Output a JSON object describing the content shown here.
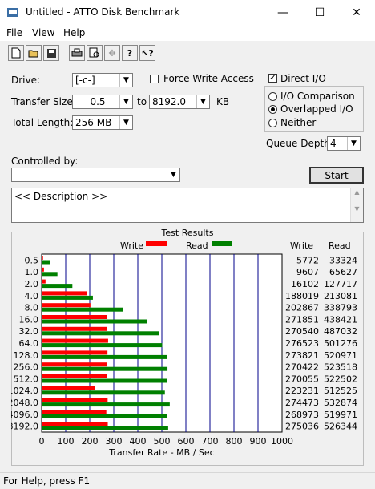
{
  "window": {
    "title": "Untitled - ATTO Disk Benchmark"
  },
  "menu": {
    "file": "File",
    "view": "View",
    "help": "Help"
  },
  "form": {
    "drive_label": "Drive:",
    "drive_value": "[-c-]",
    "force_write_label": "Force Write Access",
    "direct_io_label": "Direct I/O",
    "io_comparison_label": "I/O Comparison",
    "overlapped_io_label": "Overlapped I/O",
    "neither_label": "Neither",
    "transfer_size_label": "Transfer Size:",
    "transfer_from": "0.5",
    "to_label": "to",
    "transfer_to": "8192.0",
    "kb_label": "KB",
    "total_length_label": "Total Length:",
    "total_length_value": "256 MB",
    "queue_depth_label": "Queue Depth:",
    "queue_depth_value": "4",
    "controlled_by_label": "Controlled by:",
    "controlled_by_value": "",
    "start_label": "Start",
    "description": "<< Description >>"
  },
  "results": {
    "title": "Test Results",
    "write_label": "Write",
    "read_label": "Read",
    "col_write": "Write",
    "col_read": "Read",
    "xlabel": "Transfer Rate - MB / Sec"
  },
  "status": {
    "text": "For Help, press F1"
  },
  "colors": {
    "write": "#ff0000",
    "read": "#008000",
    "grid": "#00008b"
  },
  "chart_data": {
    "type": "bar",
    "orientation": "horizontal",
    "categories": [
      "0.5",
      "1.0",
      "2.0",
      "4.0",
      "8.0",
      "16.0",
      "32.0",
      "64.0",
      "128.0",
      "256.0",
      "512.0",
      "1024.0",
      "2048.0",
      "4096.0",
      "8192.0"
    ],
    "series": [
      {
        "name": "Write",
        "values": [
          5772,
          9607,
          16102,
          188019,
          202867,
          271851,
          270540,
          276523,
          273821,
          270422,
          270055,
          223231,
          274473,
          268973,
          275036
        ]
      },
      {
        "name": "Read",
        "values": [
          33324,
          65627,
          127717,
          213081,
          338793,
          438421,
          487032,
          501276,
          520971,
          523518,
          522502,
          512525,
          532874,
          519971,
          526344
        ]
      }
    ],
    "xlim": [
      0,
      1000
    ],
    "xticks": [
      "0",
      "100",
      "200",
      "300",
      "400",
      "500",
      "600",
      "700",
      "800",
      "900",
      "1000"
    ],
    "xlabel": "Transfer Rate - MB / Sec",
    "legend": "top"
  }
}
